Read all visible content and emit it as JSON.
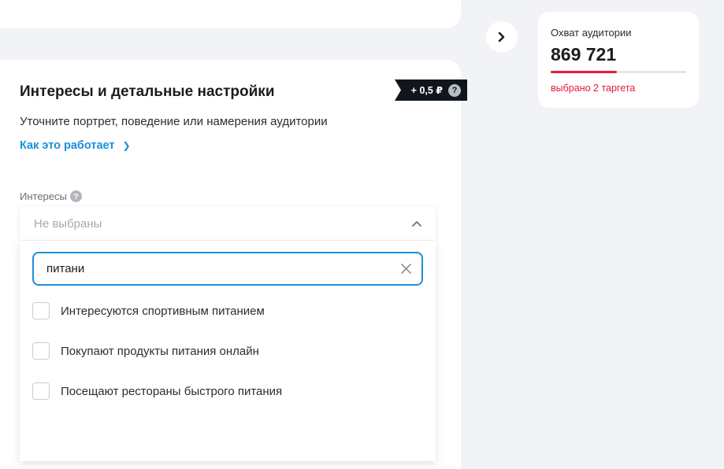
{
  "colors": {
    "accent": "#1a8fdc",
    "alert": "#e5173f",
    "badge_bg": "#11161c",
    "page_bg": "#f2f3f7"
  },
  "section": {
    "title": "Интересы и детальные настройки",
    "price_badge": "+ 0,5 ₽",
    "price_help_icon": "question-icon",
    "subtitle": "Уточните портрет, поведение или намерения аудитории",
    "how_link": "Как это работает",
    "how_link_icon": "chevron-right-icon"
  },
  "interests": {
    "label": "Интересы",
    "label_help_icon": "question-icon",
    "selected_value": "Не выбраны",
    "toggle_icon": "chevron-up-icon",
    "search": {
      "value": "питани",
      "clear_icon": "close-icon"
    },
    "options": [
      {
        "label": "Интересуются спортивным питанием",
        "checked": false
      },
      {
        "label": "Покупают продукты питания онлайн",
        "checked": false
      },
      {
        "label": "Посещают рестораны быстрого питания",
        "checked": false
      }
    ]
  },
  "next_button": {
    "icon": "chevron-right-icon"
  },
  "reach": {
    "title": "Охват аудитории",
    "value": "869 721",
    "progress_fraction": 0.49,
    "note": "выбрано 2 таргета"
  }
}
